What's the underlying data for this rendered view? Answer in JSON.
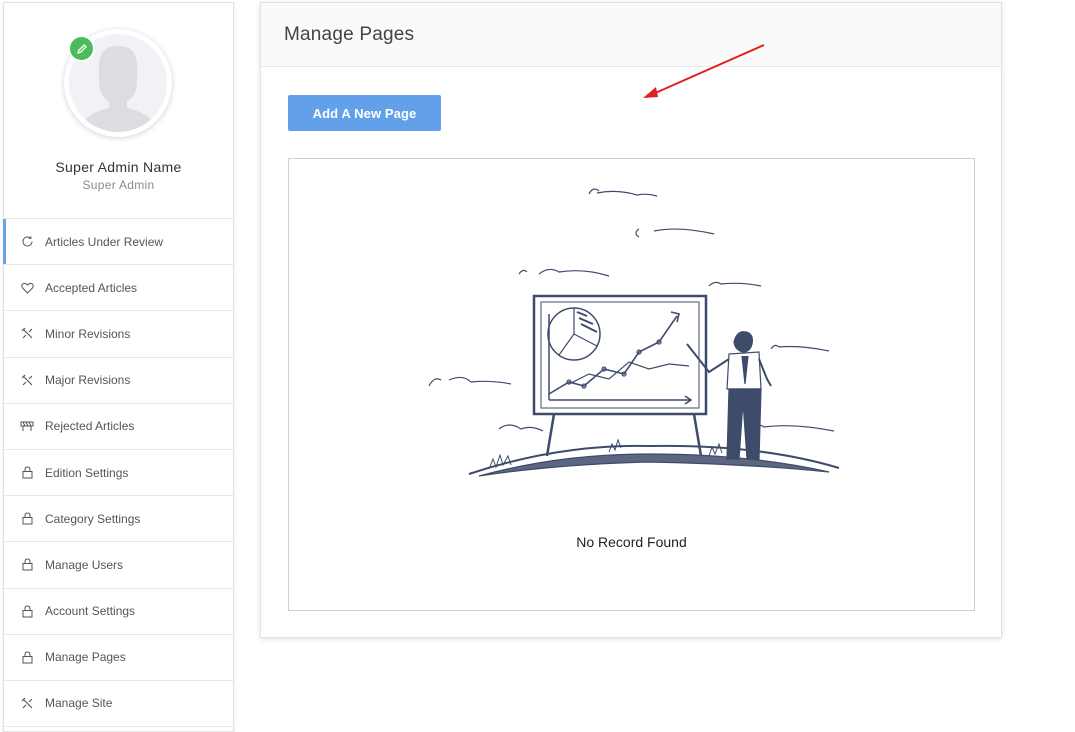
{
  "profile": {
    "name": "Super Admin Name",
    "role": "Super Admin"
  },
  "sidebar": {
    "items": [
      {
        "label": "Articles Under Review",
        "icon": "refresh-icon"
      },
      {
        "label": "Accepted Articles",
        "icon": "heart-icon"
      },
      {
        "label": "Minor Revisions",
        "icon": "tools-icon"
      },
      {
        "label": "Major Revisions",
        "icon": "tools-icon"
      },
      {
        "label": "Rejected Articles",
        "icon": "barrier-icon"
      },
      {
        "label": "Edition Settings",
        "icon": "lock-icon"
      },
      {
        "label": "Category Settings",
        "icon": "lock-icon"
      },
      {
        "label": "Manage Users",
        "icon": "lock-icon"
      },
      {
        "label": "Account Settings",
        "icon": "lock-icon"
      },
      {
        "label": "Manage Pages",
        "icon": "lock-icon"
      },
      {
        "label": "Manage Site",
        "icon": "tools-icon"
      }
    ]
  },
  "main": {
    "title": "Manage Pages",
    "add_button": "Add A New Page",
    "empty_text": "No Record Found"
  },
  "colors": {
    "accent": "#62a0ea",
    "edit_badge": "#4cbb5a",
    "annotation_arrow": "#e02020"
  }
}
